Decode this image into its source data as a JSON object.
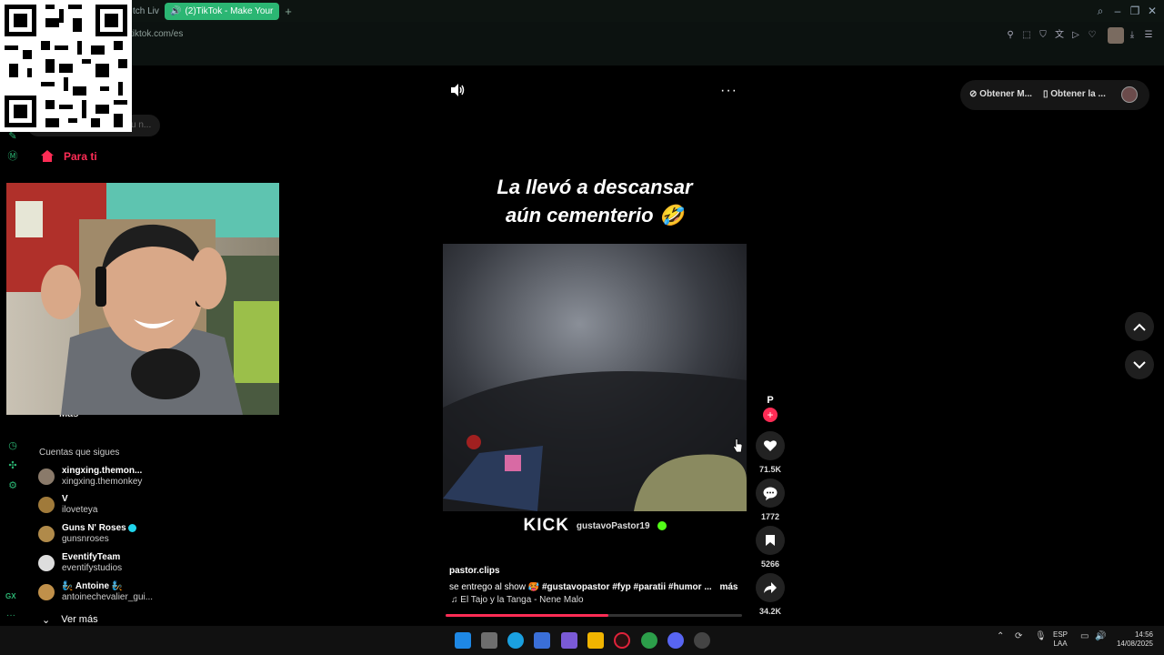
{
  "browser": {
    "tabs": [
      {
        "label": "tch Liv"
      },
      {
        "label": "(2)TikTok - Make Your"
      }
    ],
    "url": "tiktok.com/es"
  },
  "sidebar": {
    "search_placeholder": "u n...",
    "nav": {
      "para_ti": "Para ti",
      "mas": "Más"
    },
    "following_title": "Cuentas que sigues",
    "accounts": [
      {
        "name": "xingxing.themon...",
        "handle": "xingxing.themonkey",
        "avatar_color": "#8a7a6a"
      },
      {
        "name": "V",
        "handle": "iloveteya",
        "avatar_color": "#a07a3a"
      },
      {
        "name": "Guns N' Roses",
        "handle": "gunsnroses",
        "avatar_color": "#b08a4a",
        "verified": true
      },
      {
        "name": "EventifyTeam",
        "handle": "eventifystudios",
        "avatar_color": "#dddddd"
      },
      {
        "name": "🧞 Antoine 🧞",
        "handle": "antoinechevalier_gui...",
        "avatar_color": "#c0904a"
      }
    ],
    "ver_mas": "Ver más",
    "gx_label": "GX"
  },
  "video": {
    "caption_line1": "La llevó a descansar",
    "caption_line2": "aún cementerio 🤣",
    "kick_logo": "KICK",
    "kick_user": "gustavoPastor19",
    "author": "pastor.clips",
    "description": "se entrego al show 🥵",
    "hashtags": "#gustavopastor  #fyp  #paratii  #humor ...",
    "more": "más",
    "music": "♫  El Tajo y la Tanga - Nene Malo",
    "progress": 0.55
  },
  "actions": {
    "creator_initial": "P",
    "likes": "71.5K",
    "comments": "1772",
    "saves": "5266",
    "shares": "34.2K"
  },
  "promo": {
    "get_app_1": "Obtener M...",
    "get_app_2": "Obtener la ..."
  },
  "taskbar": {
    "lang_1": "ESP",
    "lang_2": "LAA",
    "time": "14:56",
    "date": "14/08/2025"
  },
  "colors": {
    "accent": "#fe2c55",
    "opera_gx": "#2bb673"
  }
}
